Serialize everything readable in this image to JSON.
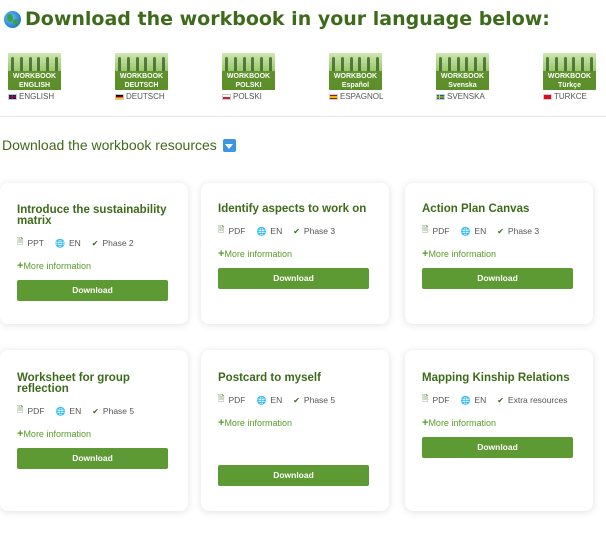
{
  "header": {
    "title": "Download the workbook in your language below:"
  },
  "languages": [
    {
      "cover_title": "WORKBOOK",
      "cover_lang": "ENGLISH",
      "caption": "ENGLISH",
      "flag": "en"
    },
    {
      "cover_title": "WORKBOOK",
      "cover_lang": "DEUTSCH",
      "caption": "DEUTSCH",
      "flag": "de"
    },
    {
      "cover_title": "WORKBOOK",
      "cover_lang": "POLSKI",
      "caption": "POLSKI",
      "flag": "pl"
    },
    {
      "cover_title": "WORKBOOK",
      "cover_lang": "Español",
      "caption": "ESPAGNOL",
      "flag": "es"
    },
    {
      "cover_title": "WORKBOOK",
      "cover_lang": "Svenska",
      "caption": "SVENSKA",
      "flag": "sv"
    },
    {
      "cover_title": "WORKBOOK",
      "cover_lang": "Türkçe",
      "caption": "TURKCE",
      "flag": "tr"
    }
  ],
  "resources": {
    "title": "Download the workbook resources",
    "more_label": "More information",
    "download_label": "Download",
    "cards": [
      {
        "title": "Introduce the sustainability matrix",
        "format": "PPT",
        "language": "EN",
        "phase": "Phase 2"
      },
      {
        "title": "Identify aspects to work on",
        "format": "PDF",
        "language": "EN",
        "phase": "Phase 3"
      },
      {
        "title": "Action Plan Canvas",
        "format": "PDF",
        "language": "EN",
        "phase": "Phase 3"
      },
      {
        "title": "Worksheet for group reflection",
        "format": "PDF",
        "language": "EN",
        "phase": "Phase 5"
      },
      {
        "title": "Postcard to myself",
        "format": "PDF",
        "language": "EN",
        "phase": "Phase 5"
      },
      {
        "title": "Mapping Kinship Relations",
        "format": "PDF",
        "language": "EN",
        "phase": "Extra resources"
      }
    ]
  },
  "colors": {
    "brand_green": "#3d6b1b",
    "button_green": "#5e9a33",
    "link_green": "#5a9a2c"
  }
}
